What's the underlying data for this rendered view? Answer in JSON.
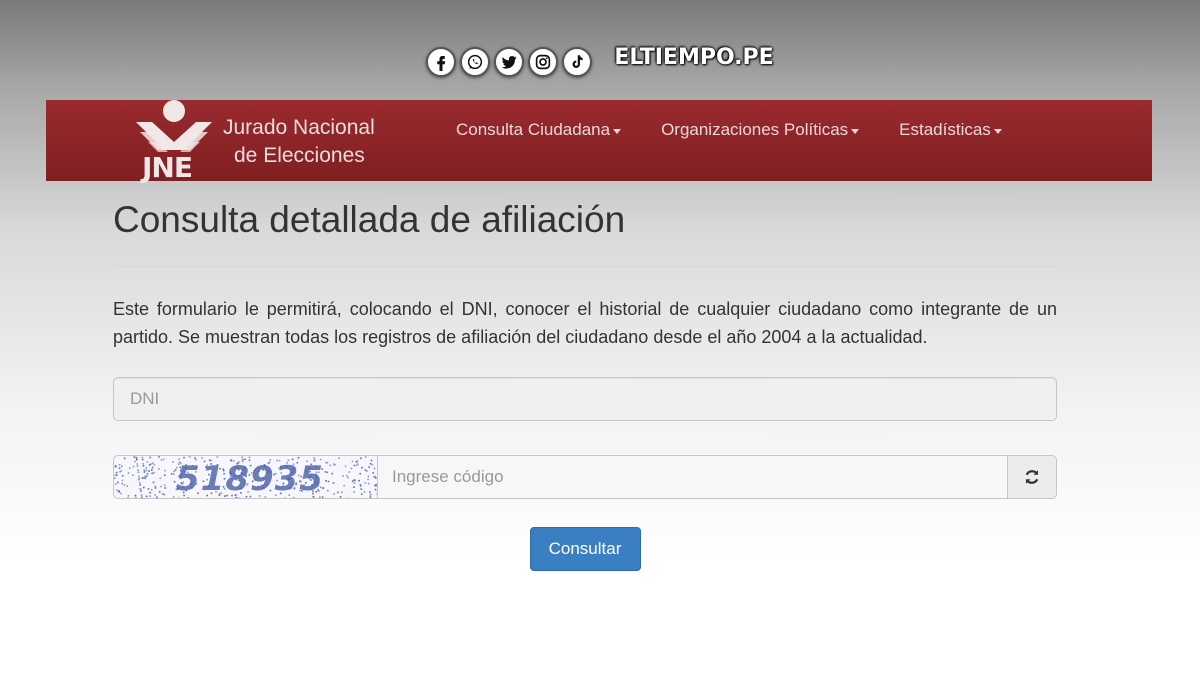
{
  "social": {
    "icons": [
      "facebook-icon",
      "whatsapp-icon",
      "twitter-icon",
      "instagram-icon",
      "tiktok-icon"
    ],
    "brand": "ELTIEMPO.PE"
  },
  "header": {
    "logo_abbr": "JNE",
    "logo_line1": "Jurado Nacional",
    "logo_line2": "de Elecciones",
    "menu": [
      {
        "label": "Consulta Ciudadana"
      },
      {
        "label": "Organizaciones Políticas"
      },
      {
        "label": "Estadísticas"
      }
    ]
  },
  "main": {
    "title": "Consulta detallada de afiliación",
    "description": "Este formulario le permitirá, colocando el DNI, conocer el historial de cualquier ciudadano como integrante de un partido. Se muestran todas los registros de afiliación del ciudadano desde el año 2004 a la actualidad.",
    "dni_placeholder": "DNI",
    "captcha_code": "518935",
    "code_placeholder": "Ingrese código",
    "submit_label": "Consultar"
  },
  "colors": {
    "navbar": "#8b2226",
    "button": "#3a7fc1"
  }
}
